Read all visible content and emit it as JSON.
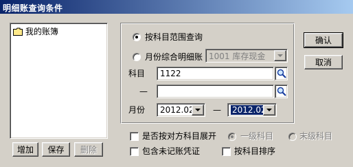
{
  "window": {
    "title": "明细账查询条件"
  },
  "tree": {
    "root_label": "我的账簿"
  },
  "left_buttons": {
    "add": "增加",
    "save": "保存",
    "delete": "删除"
  },
  "right_buttons": {
    "ok": "确认",
    "cancel": "取消"
  },
  "query": {
    "by_subject_label": "按科目范围查询",
    "monthly_label": "月份综合明细账",
    "monthly_account_value": "1001 库存现金",
    "subject_label": "科目",
    "subject_from_value": "1122",
    "subject_dash": "—",
    "subject_to_value": "",
    "month_label": "月份",
    "month_from_value": "2012.02",
    "month_dash": "—",
    "month_to_value": "2012.02"
  },
  "options": {
    "expand_contra_label": "是否按对方科目展开",
    "level1_label": "一级科目",
    "last_level_label": "末级科目",
    "include_unposted_label": "包含未记账凭证",
    "sort_by_subject_label": "按科目排序"
  },
  "icons": {
    "folder": "folder-icon",
    "search": "magnifier-icon",
    "dropdown": "chevron-down-icon"
  }
}
